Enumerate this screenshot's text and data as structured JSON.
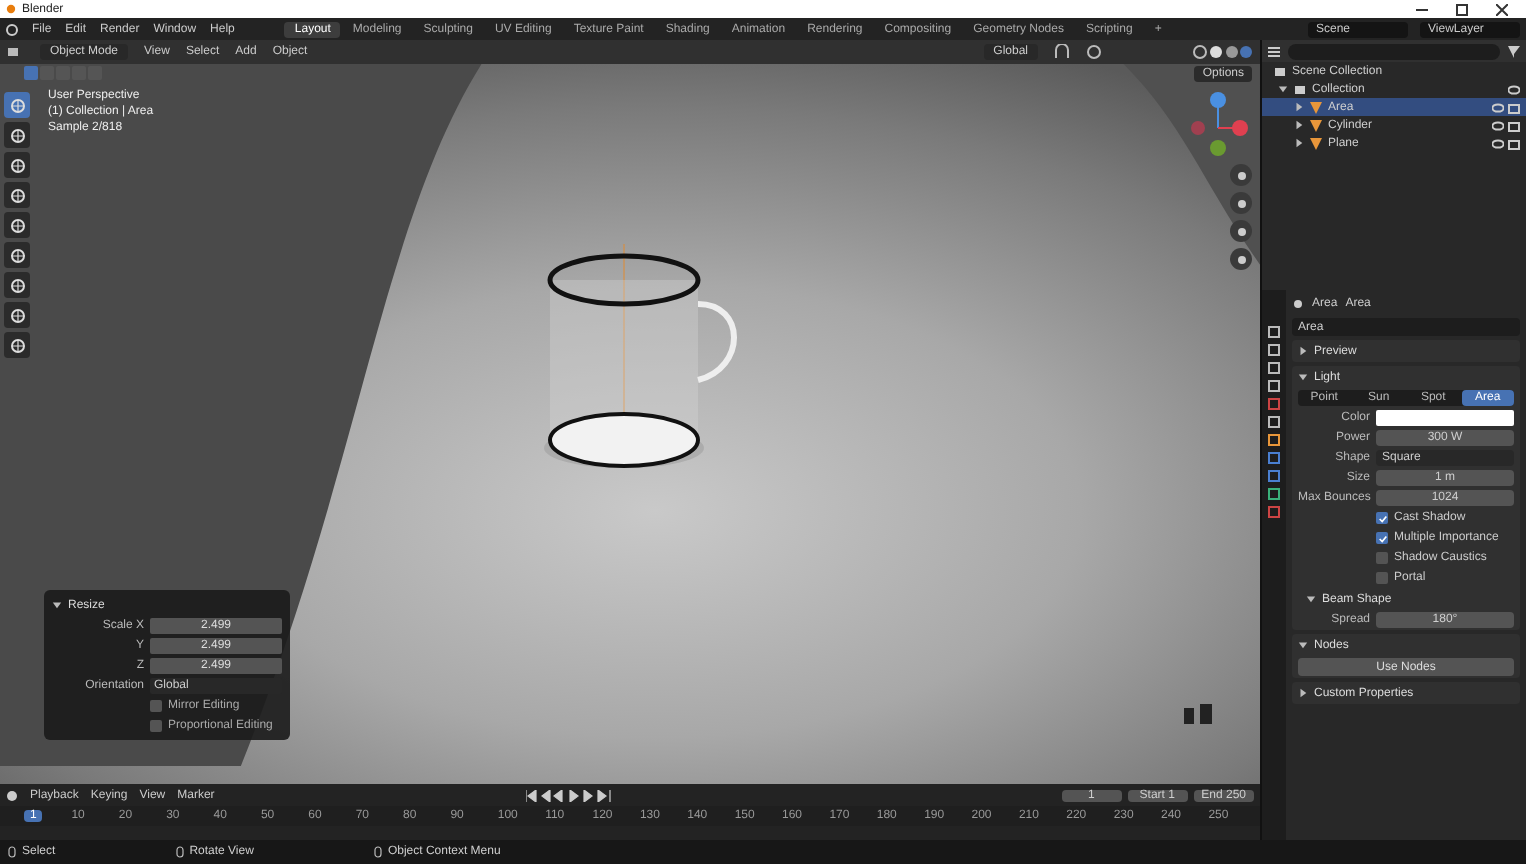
{
  "window": {
    "title": "Blender"
  },
  "menu": [
    "File",
    "Edit",
    "Render",
    "Window",
    "Help"
  ],
  "workspaces": [
    {
      "label": "Layout",
      "selected": true
    },
    {
      "label": "Modeling",
      "selected": false
    },
    {
      "label": "Sculpting",
      "selected": false
    },
    {
      "label": "UV Editing",
      "selected": false
    },
    {
      "label": "Texture Paint",
      "selected": false
    },
    {
      "label": "Shading",
      "selected": false
    },
    {
      "label": "Animation",
      "selected": false
    },
    {
      "label": "Rendering",
      "selected": false
    },
    {
      "label": "Compositing",
      "selected": false
    },
    {
      "label": "Geometry Nodes",
      "selected": false
    },
    {
      "label": "Scripting",
      "selected": false
    }
  ],
  "add_workspace": "+",
  "scene": "Scene",
  "view_layer": "ViewLayer",
  "header": {
    "mode": "Object Mode",
    "menus": [
      "View",
      "Select",
      "Add",
      "Object"
    ],
    "orientation": "Global",
    "options": "Options"
  },
  "viewport": {
    "overlay": [
      "User Perspective",
      "(1) Collection | Area",
      "Sample 2/818"
    ]
  },
  "redo_panel": {
    "title": "Resize",
    "fields": [
      {
        "label": "Scale X",
        "value": "2.499"
      },
      {
        "label": "Y",
        "value": "2.499"
      },
      {
        "label": "Z",
        "value": "2.499"
      }
    ],
    "orientation_label": "Orientation",
    "orientation": "Global",
    "checks": [
      {
        "label": "Mirror Editing",
        "checked": false
      },
      {
        "label": "Proportional Editing",
        "checked": false
      }
    ]
  },
  "outliner": {
    "root": "Scene Collection",
    "tree": [
      {
        "name": "Collection",
        "expanded": true,
        "children": [
          {
            "name": "Area",
            "selected": true
          },
          {
            "name": "Cylinder",
            "selected": false
          },
          {
            "name": "Plane",
            "selected": false
          }
        ]
      }
    ]
  },
  "properties": {
    "breadcrumb": [
      "Area",
      "Area"
    ],
    "datablock": "Area",
    "preview": {
      "title": "Preview",
      "expanded": false
    },
    "light": {
      "title": "Light",
      "expanded": true,
      "types": [
        {
          "label": "Point",
          "selected": false
        },
        {
          "label": "Sun",
          "selected": false
        },
        {
          "label": "Spot",
          "selected": false
        },
        {
          "label": "Area",
          "selected": true
        }
      ],
      "rows": [
        {
          "kind": "color",
          "label": "Color",
          "color": "#ffffff"
        },
        {
          "kind": "field",
          "label": "Power",
          "value": "300 W"
        },
        {
          "kind": "dropdown",
          "label": "Shape",
          "value": "Square"
        },
        {
          "kind": "field",
          "label": "Size",
          "value": "1 m"
        },
        {
          "kind": "field",
          "label": "Max Bounces",
          "value": "1024"
        },
        {
          "kind": "checkbox",
          "label": "Cast Shadow",
          "checked": true
        },
        {
          "kind": "checkbox",
          "label": "Multiple Importance",
          "checked": true
        },
        {
          "kind": "checkbox",
          "label": "Shadow Caustics",
          "checked": false
        },
        {
          "kind": "checkbox",
          "label": "Portal",
          "checked": false
        }
      ]
    },
    "beam": {
      "title": "Beam Shape",
      "expanded": true,
      "label": "Spread",
      "value": "180°"
    },
    "nodes": {
      "title": "Nodes",
      "expanded": true,
      "button": "Use Nodes"
    },
    "custom": {
      "title": "Custom Properties",
      "expanded": false
    }
  },
  "timeline": {
    "menus": [
      "Playback",
      "Keying",
      "View",
      "Marker"
    ],
    "frame": "1",
    "start_label": "Start",
    "start": "1",
    "end_label": "End",
    "end": "250",
    "ticks": [
      "1",
      "10",
      "20",
      "30",
      "40",
      "50",
      "60",
      "70",
      "80",
      "90",
      "100",
      "110",
      "120",
      "130",
      "140",
      "150",
      "160",
      "170",
      "180",
      "190",
      "200",
      "210",
      "220",
      "230",
      "240",
      "250"
    ]
  },
  "status_bar": [
    "Select",
    "Rotate View",
    "Object Context Menu"
  ]
}
